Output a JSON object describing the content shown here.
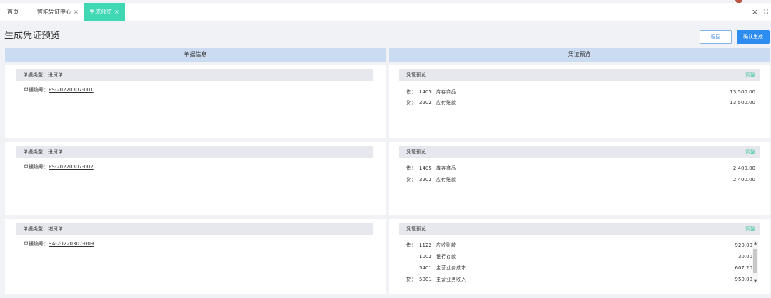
{
  "tabs": {
    "home": "首页",
    "center": "智能凭证中心",
    "preview": "生成预览",
    "close_mark": "×"
  },
  "window": {
    "close": "×",
    "fullscreen": "⛶"
  },
  "page": {
    "title": "生成凭证预览",
    "back_label": "返回",
    "confirm_label": "确认生成"
  },
  "columns": {
    "left": "单据信息",
    "right": "凭证预览"
  },
  "labels": {
    "doc_type_prefix": "单据类型：",
    "doc_no_prefix": "单据编号：",
    "voucher_preview": "凭证预览",
    "adjust": "调整"
  },
  "documents": [
    {
      "type": "进货单",
      "number": "PS-20220307-001",
      "entries": [
        {
          "dir": "借：",
          "code": "1405",
          "name": "库存商品",
          "amount": "13,500.00"
        },
        {
          "dir": "贷：",
          "code": "2202",
          "name": "应付账款",
          "amount": "13,500.00"
        }
      ]
    },
    {
      "type": "进货单",
      "number": "PS-20220307-002",
      "entries": [
        {
          "dir": "借：",
          "code": "1405",
          "name": "库存商品",
          "amount": "2,400.00"
        },
        {
          "dir": "贷：",
          "code": "2202",
          "name": "应付账款",
          "amount": "2,400.00"
        }
      ]
    },
    {
      "type": "销货单",
      "number": "SA-20220307-009",
      "entries": [
        {
          "dir": "借：",
          "code": "1122",
          "name": "应收账款",
          "amount": "920.00"
        },
        {
          "dir": "",
          "code": "1002",
          "name": "银行存款",
          "amount": "30.00"
        },
        {
          "dir": "",
          "code": "5401",
          "name": "主营业务成本",
          "amount": "607.20"
        },
        {
          "dir": "贷：",
          "code": "5001",
          "name": "主营业务收入",
          "amount": "950.00"
        }
      ]
    }
  ],
  "colors": {
    "accent_tab": "#40d7b5",
    "primary": "#2d8cf0",
    "header_bg": "#cbdcf2",
    "adjust": "#40c5a0"
  }
}
